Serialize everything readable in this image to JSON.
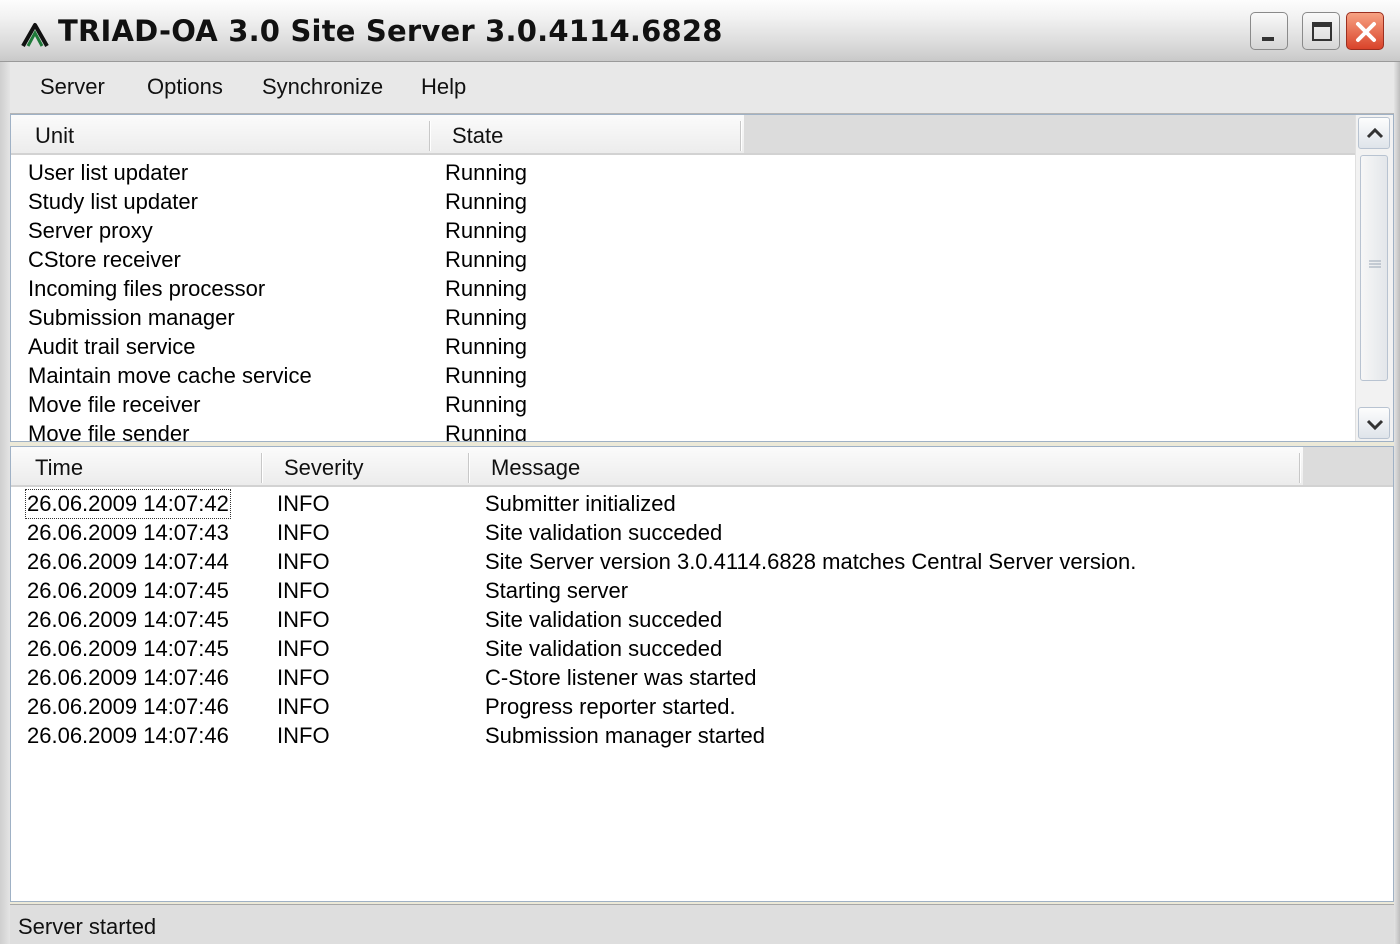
{
  "window": {
    "title": "TRIAD-OA 3.0 Site Server 3.0.4114.6828"
  },
  "menu": [
    "Server",
    "Options",
    "Synchronize",
    "Help"
  ],
  "units": {
    "columns": [
      "Unit",
      "State"
    ],
    "rows": [
      {
        "unit": "User list updater",
        "state": "Running"
      },
      {
        "unit": "Study list updater",
        "state": "Running"
      },
      {
        "unit": "Server proxy",
        "state": "Running"
      },
      {
        "unit": "CStore receiver",
        "state": "Running"
      },
      {
        "unit": "Incoming files processor",
        "state": "Running"
      },
      {
        "unit": "Submission manager",
        "state": "Running"
      },
      {
        "unit": "Audit trail service",
        "state": "Running"
      },
      {
        "unit": "Maintain move cache service",
        "state": "Running"
      },
      {
        "unit": "Move file receiver",
        "state": "Running"
      },
      {
        "unit": "Move file sender",
        "state": "Running"
      }
    ]
  },
  "log": {
    "columns": [
      "Time",
      "Severity",
      "Message"
    ],
    "rows": [
      {
        "time": "26.06.2009 14:07:42",
        "severity": "INFO",
        "message": "Submitter initialized"
      },
      {
        "time": "26.06.2009 14:07:43",
        "severity": "INFO",
        "message": "Site validation succeded"
      },
      {
        "time": "26.06.2009 14:07:44",
        "severity": "INFO",
        "message": "Site Server version 3.0.4114.6828 matches Central Server version."
      },
      {
        "time": "26.06.2009 14:07:45",
        "severity": "INFO",
        "message": "Starting server"
      },
      {
        "time": "26.06.2009 14:07:45",
        "severity": "INFO",
        "message": "Site validation succeded"
      },
      {
        "time": "26.06.2009 14:07:45",
        "severity": "INFO",
        "message": "Site validation succeded"
      },
      {
        "time": "26.06.2009 14:07:46",
        "severity": "INFO",
        "message": "C-Store listener was started"
      },
      {
        "time": "26.06.2009 14:07:46",
        "severity": "INFO",
        "message": "Progress reporter started."
      },
      {
        "time": "26.06.2009 14:07:46",
        "severity": "INFO",
        "message": "Submission manager started"
      }
    ]
  },
  "status": {
    "text": "Server started"
  },
  "icons": {
    "app": "triad-logo-icon",
    "minimize": "minimize-icon",
    "maximize": "maximize-icon",
    "close": "close-icon",
    "scroll_up": "scroll-up-arrow-icon",
    "scroll_down": "scroll-down-arrow-icon"
  },
  "colors": {
    "close_button": "#d9432a",
    "logo": "#1f7a3a"
  }
}
